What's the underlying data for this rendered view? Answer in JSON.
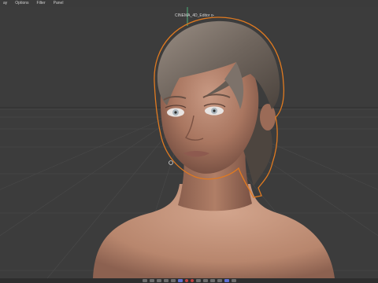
{
  "menu": {
    "items": [
      "ay",
      "Options",
      "Filter",
      "Panel"
    ]
  },
  "viewport": {
    "camera_label": "CINEMA_4D_Editor ⊳",
    "background_color": "#3c3c3c",
    "grid_color": "#4a4a4a",
    "selection_outline_color": "#e07a20",
    "axis_color": "#4fd08a"
  },
  "timeline": {
    "buttons": [
      "frame-start-icon",
      "prev-key-icon",
      "play-icon",
      "next-key-icon",
      "frame-end-icon",
      "record-icon",
      "autokey-icon",
      "keyframe-icon",
      "position-icon",
      "rotation-icon",
      "scale-icon",
      "parameter-icon",
      "pla-icon",
      "grid-icon"
    ]
  }
}
